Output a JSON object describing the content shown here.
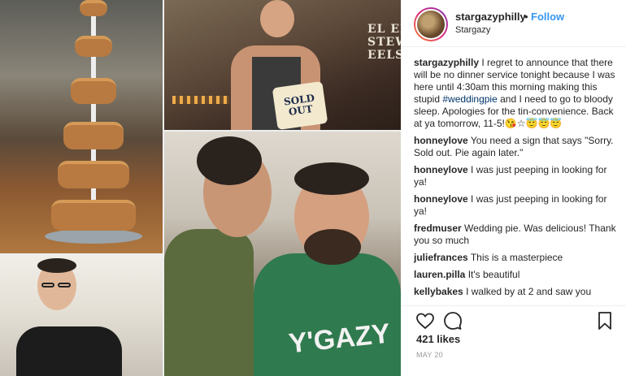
{
  "post": {
    "username": "stargazyphilly",
    "separator": "•",
    "follow_label": "Follow",
    "location": "Stargazy"
  },
  "collage": {
    "shop_sign_text": "EL ED & STEWED EELS",
    "sign_text": "SOLD OUT",
    "shirt_text": "Y'GAZY"
  },
  "caption": {
    "username": "stargazyphilly",
    "text_before": "I regret to announce that there will be no dinner service tonight because I was here until 4:30am this morning making this stupid",
    "hashtag": "#weddingpie",
    "text_after": "and I need to go to bloody sleep. Apologies for the tin-convenience. Back at ya tomorrow, 11-5!😘☆😇😇😇"
  },
  "comments": [
    {
      "user": "honneylove",
      "text": "You need a sign that says \"Sorry. Sold out. Pie again later.\""
    },
    {
      "user": "honneylove",
      "text": "I was just peeping in looking for ya!"
    },
    {
      "user": "honneylove",
      "text": "I was just peeping in looking for ya!"
    },
    {
      "user": "fredmuser",
      "text": "Wedding pie. Was delicious! Thank you so much"
    },
    {
      "user": "juliefrances",
      "text": "This is a masterpiece"
    },
    {
      "user": "lauren.pilla",
      "text": "It's beautiful"
    },
    {
      "user": "kellybakes",
      "text": "I walked by at 2 and saw you"
    }
  ],
  "actions": {
    "likes": "421 likes",
    "date": "MAY 20"
  },
  "icons": [
    "heart-icon",
    "comment-icon",
    "bookmark-icon"
  ]
}
